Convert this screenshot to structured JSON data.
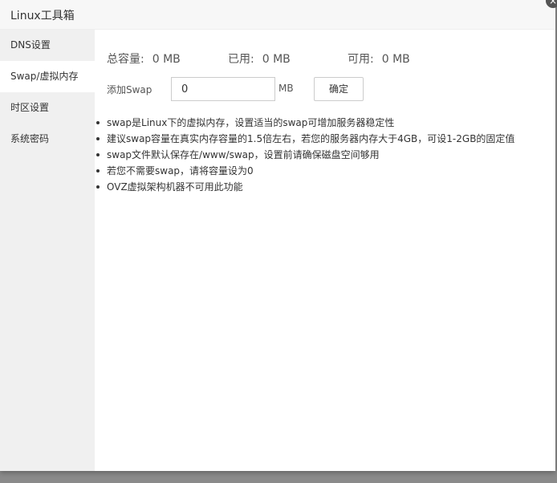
{
  "window": {
    "title": "Linux工具箱",
    "close_icon": "×"
  },
  "sidebar": {
    "items": [
      {
        "label": "DNS设置",
        "active": false
      },
      {
        "label": "Swap/虚拟内存",
        "active": true
      },
      {
        "label": "时区设置",
        "active": false
      },
      {
        "label": "系统密码",
        "active": false
      }
    ]
  },
  "swap": {
    "total_label": "总容量:",
    "total_value": "0 MB",
    "used_label": "已用:",
    "used_value": "0 MB",
    "available_label": "可用:",
    "available_value": "0 MB",
    "add_label": "添加Swap",
    "input_value": "0",
    "unit": "MB",
    "confirm_label": "确定"
  },
  "tips": [
    "swap是Linux下的虚拟内存，设置适当的swap可增加服务器稳定性",
    "建议swap容量在真实内存容量的1.5倍左右，若您的服务器内存大于4GB，可设1-2GB的固定值",
    "swap文件默认保存在/www/swap，设置前请确保磁盘空间够用",
    "若您不需要swap，请将容量设为0",
    "OVZ虚拟架构机器不可用此功能"
  ]
}
